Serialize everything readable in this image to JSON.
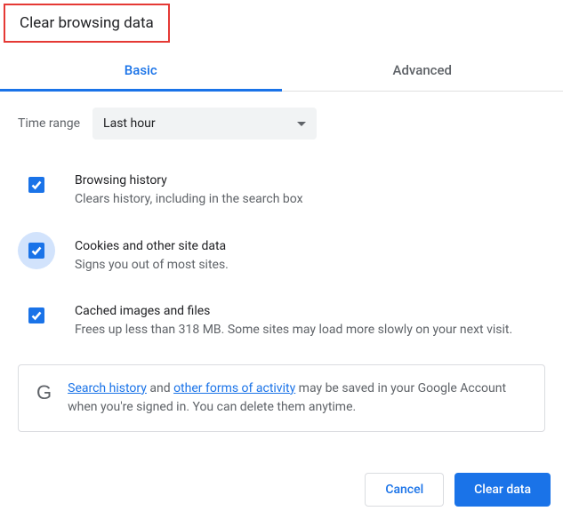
{
  "title": "Clear browsing data",
  "tabs": {
    "basic": "Basic",
    "advanced": "Advanced"
  },
  "time": {
    "label": "Time range",
    "value": "Last hour"
  },
  "options": [
    {
      "title": "Browsing history",
      "desc": "Clears history, including in the search box"
    },
    {
      "title": "Cookies and other site data",
      "desc": "Signs you out of most sites."
    },
    {
      "title": "Cached images and files",
      "desc": "Frees up less than 318 MB. Some sites may load more slowly on your next visit."
    }
  ],
  "info": {
    "icon": "G",
    "link1": "Search history",
    "mid1": " and ",
    "link2": "other forms of activity",
    "tail": " may be saved in your Google Account when you're signed in. You can delete them anytime."
  },
  "buttons": {
    "cancel": "Cancel",
    "clear": "Clear data"
  }
}
